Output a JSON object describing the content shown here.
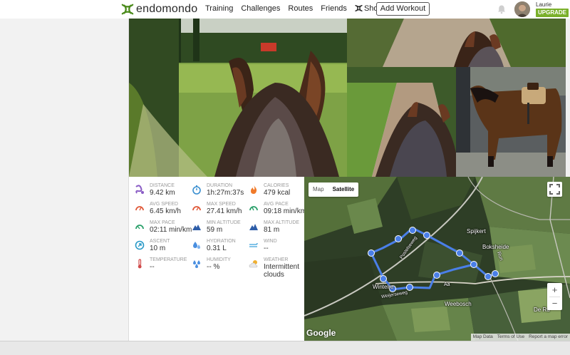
{
  "app": {
    "logo_text": "endomondo",
    "brand_color": "#7ab02a"
  },
  "nav": {
    "items": [
      {
        "label": "Training"
      },
      {
        "label": "Challenges"
      },
      {
        "label": "Routes"
      },
      {
        "label": "Friends"
      },
      {
        "label": "Shop"
      }
    ],
    "add_workout_label": "Add Workout"
  },
  "user": {
    "name": "Laurie",
    "upgrade_label": "UPGRADE"
  },
  "photos": [
    {
      "name": "horse ears over green field with tractor"
    },
    {
      "name": "horse ears on forest path"
    },
    {
      "name": "horse mane on dirt track by corn field"
    },
    {
      "name": "saddled brown horse at stable"
    }
  ],
  "stats": [
    {
      "label": "DISTANCE",
      "value": "9.42 km",
      "icon": "distance-icon",
      "color": "#8a5cc5"
    },
    {
      "label": "DURATION",
      "value": "1h:27m:37s",
      "icon": "stopwatch-icon",
      "color": "#3a8fd0"
    },
    {
      "label": "CALORIES",
      "value": "479 kcal",
      "icon": "flame-icon",
      "color": "#f07a2a"
    },
    {
      "label": "AVG SPEED",
      "value": "6.45 km/h",
      "icon": "speed-gauge-icon",
      "color": "#e05a3a"
    },
    {
      "label": "MAX SPEED",
      "value": "27.41 km/h",
      "icon": "speed-gauge-icon",
      "color": "#e05a3a"
    },
    {
      "label": "AVG PACE",
      "value": "09:18 min/km",
      "icon": "pace-gauge-icon",
      "color": "#2aa06a"
    },
    {
      "label": "MAX PACE",
      "value": "02:11 min/km",
      "icon": "pace-gauge-icon",
      "color": "#2aa06a"
    },
    {
      "label": "MIN ALTITUDE",
      "value": "59 m",
      "icon": "mountain-icon",
      "color": "#2d5da8"
    },
    {
      "label": "MAX ALTITUDE",
      "value": "81 m",
      "icon": "mountain-icon",
      "color": "#2d5da8"
    },
    {
      "label": "ASCENT",
      "value": "10 m",
      "icon": "ascent-icon",
      "color": "#2a9ac8"
    },
    {
      "label": "HYDRATION",
      "value": "0.31 L",
      "icon": "water-drop-icon",
      "color": "#4a8fe0"
    },
    {
      "label": "WIND",
      "value": "--",
      "icon": "wind-icon",
      "color": "#5ab0e0"
    },
    {
      "label": "TEMPERATURE",
      "value": "--",
      "icon": "thermometer-icon",
      "color": "#d04a4a"
    },
    {
      "label": "HUMIDITY",
      "value": "-- %",
      "icon": "humidity-icon",
      "color": "#4a8fe0"
    },
    {
      "label": "WEATHER",
      "value": "Intermittent clouds",
      "icon": "weather-cloud-icon",
      "color": "#f0b030"
    }
  ],
  "map": {
    "tab_map": "Map",
    "tab_satellite": "Satellite",
    "zoom_in": "+",
    "zoom_out": "−",
    "places": [
      "Spijkert",
      "Boksheide",
      "Weebosch",
      "Wintelre",
      "De Ru",
      "Aa",
      "Run"
    ],
    "roads": [
      "Postelseweg",
      "Weijerseweg"
    ],
    "google": "Google",
    "attribution": [
      "Map Data",
      "Terms of Use",
      "Report a map error"
    ],
    "route_color": "#4a7fe8"
  }
}
